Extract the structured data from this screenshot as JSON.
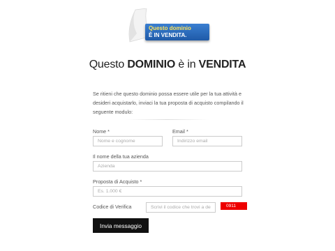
{
  "logo": {
    "line1": "Questo dominio",
    "line2": "È IN VENDITA.",
    "banner_color": "#2a6bbf",
    "line1_color": "#ffe45c"
  },
  "headline": {
    "part1": "Questo ",
    "part2": "DOMINIO",
    "part3": " è in ",
    "part4": "VENDITA"
  },
  "intro": "Se ritieni che questo dominio possa essere utile per la tua attività e desideri acquistarlo, inviaci la tua proposta di acquisto compilando il seguente modulo:",
  "form": {
    "name_label": "Nome *",
    "name_placeholder": "Nome e cognome",
    "email_label": "Email *",
    "email_placeholder": "Indirizzo email",
    "company_label": "Il nome della tua azienda",
    "company_placeholder": "Azienda",
    "offer_label": "Proposta di Acquisto *",
    "offer_placeholder": "Es. 1.000 €",
    "verify_label": "Codice di Verifica",
    "verify_placeholder": "Scrivi il codice che trovi a de",
    "captcha_code": "0911",
    "captcha_color": "#ee0000",
    "submit_label": "Invia messaggio"
  }
}
